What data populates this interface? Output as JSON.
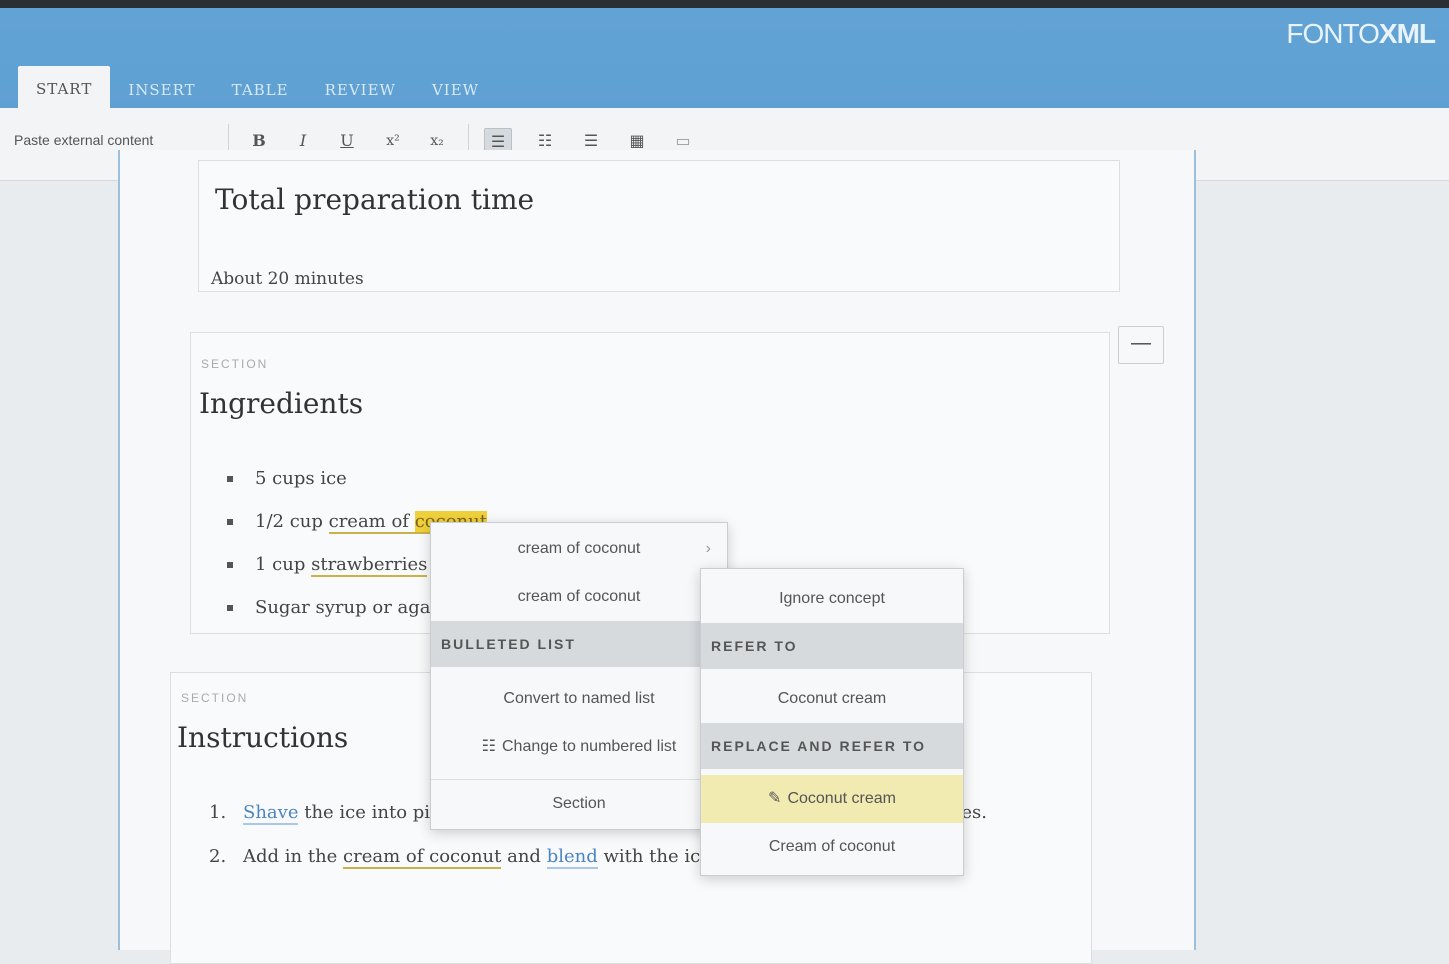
{
  "app": {
    "brand_light": "FONTO",
    "brand_bold": "XML"
  },
  "tabs": [
    {
      "label": "START",
      "active": true
    },
    {
      "label": "INSERT",
      "active": false
    },
    {
      "label": "TABLE",
      "active": false
    },
    {
      "label": "REVIEW",
      "active": false
    },
    {
      "label": "VIEW",
      "active": false
    }
  ],
  "toolbar": {
    "paste_label": "Paste external content",
    "bold": "B",
    "italic": "I",
    "underline": "U",
    "superscript": "x²",
    "subscript": "x₂",
    "list_bullets": "☰",
    "list_numbered": "☷",
    "align": "☰",
    "table": "▦",
    "other": "▭"
  },
  "document": {
    "prep_title": "Total preparation time",
    "prep_text": "About 20 minutes",
    "ingredients_label": "SECTION",
    "ingredients_title": "Ingredients",
    "ingredients": {
      "i1": "5 cups ice",
      "i2_pre": "1/2 cup ",
      "i2_link": "cream of ",
      "i2_hl": "coconut",
      "i3_pre": "1 cup ",
      "i3_link": "strawberries",
      "i4": "Sugar syrup or agave"
    },
    "instructions_label": "SECTION",
    "instructions_title": "Instructions",
    "steps": {
      "s1_num": "1.",
      "s1_link": "Shave",
      "s1_text": " the ice into pieces of desired consistency. There should be no large pieces.",
      "s2_num": "2.",
      "s2_pre": "Add in the ",
      "s2_link1": "cream of coconut",
      "s2_mid": " and ",
      "s2_link2": "blend",
      "s2_post": " with the ice for 30 seconds."
    }
  },
  "collapse_button": "—",
  "context_menu": {
    "item1": "cream of coconut",
    "item2": "cream of coconut",
    "header_list": "BULLETED LIST",
    "convert": "Convert to named list",
    "change": "Change to numbered list",
    "section": "Section"
  },
  "submenu": {
    "ignore": "Ignore concept",
    "header_refer": "REFER TO",
    "refer_item": "Coconut cream",
    "header_replace": "REPLACE AND REFER TO",
    "replace_item_active": "Coconut cream",
    "replace_item2": "Cream of coconut"
  },
  "colors": {
    "accent": "#5e9fd2",
    "highlight": "#f0d03a",
    "active_item": "#f1eab1"
  }
}
